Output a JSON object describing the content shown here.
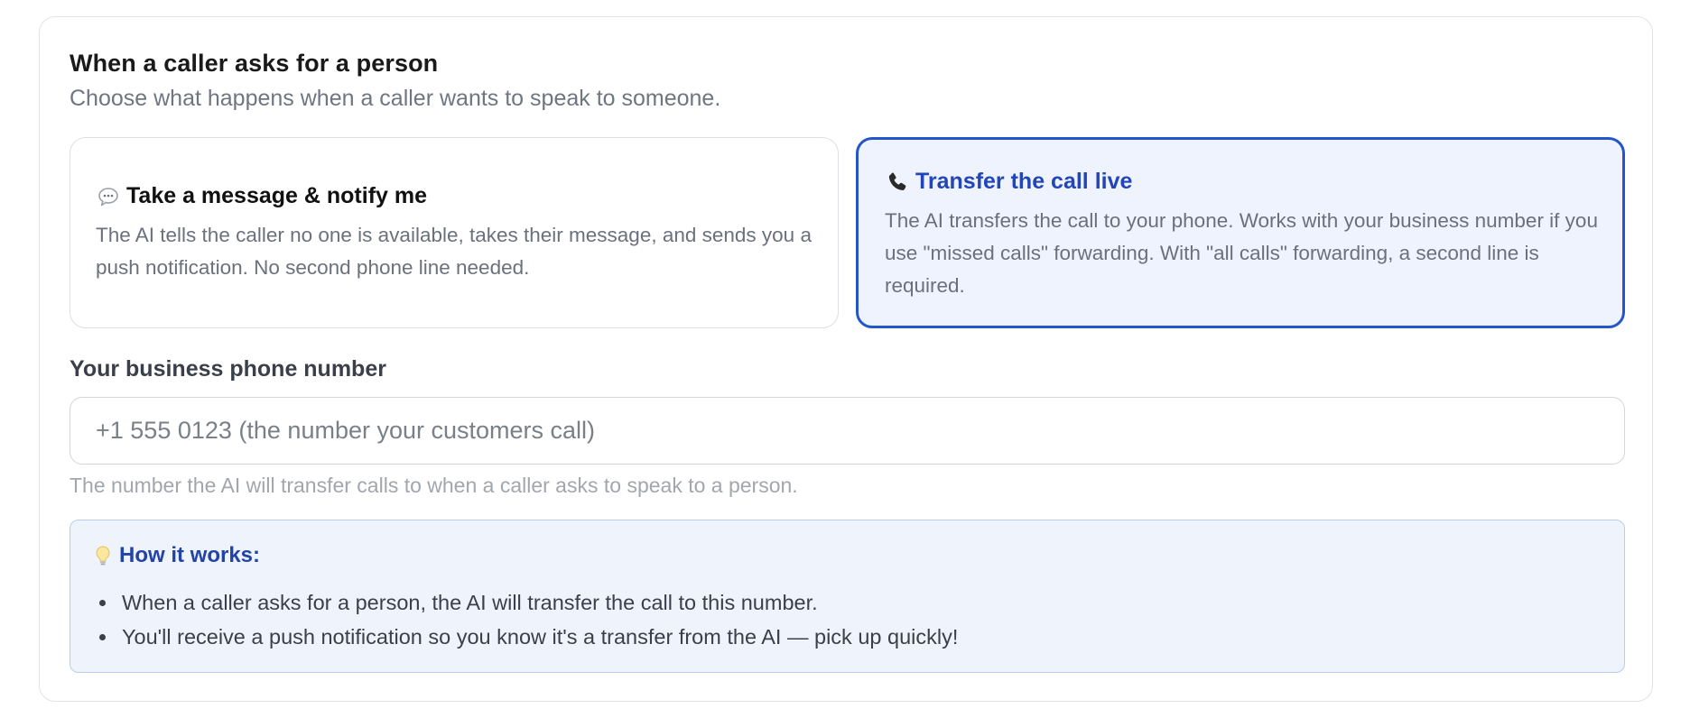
{
  "section": {
    "title": "When a caller asks for a person",
    "subtitle": "Choose what happens when a caller wants to speak to someone."
  },
  "options": [
    {
      "icon": "speech-bubble-icon",
      "title": "Take a message & notify me",
      "description": "The AI tells the caller no one is available, takes their message, and sends you a push notification. No second phone line needed.",
      "selected": false
    },
    {
      "icon": "phone-icon",
      "title": "Transfer the call live",
      "description": "The AI transfers the call to your phone. Works with your business number if you use \"missed calls\" forwarding. With \"all calls\" forwarding, a second line is required.",
      "selected": true
    }
  ],
  "phone_field": {
    "label": "Your business phone number",
    "placeholder": "+1 555 0123 (the number your customers call)",
    "value": "",
    "help": "The number the AI will transfer calls to when a caller asks to speak to a person."
  },
  "info": {
    "icon": "lightbulb-icon",
    "title": "How it works:",
    "items": [
      "When a caller asks for a person, the AI will transfer the call to this number.",
      "You'll receive a push notification so you know it's a transfer from the AI — pick up quickly!"
    ]
  },
  "colors": {
    "accent": "#2456c9",
    "selected_bg": "#eef3fd",
    "info_bg": "#eef3fc",
    "info_title": "#2443a6"
  }
}
